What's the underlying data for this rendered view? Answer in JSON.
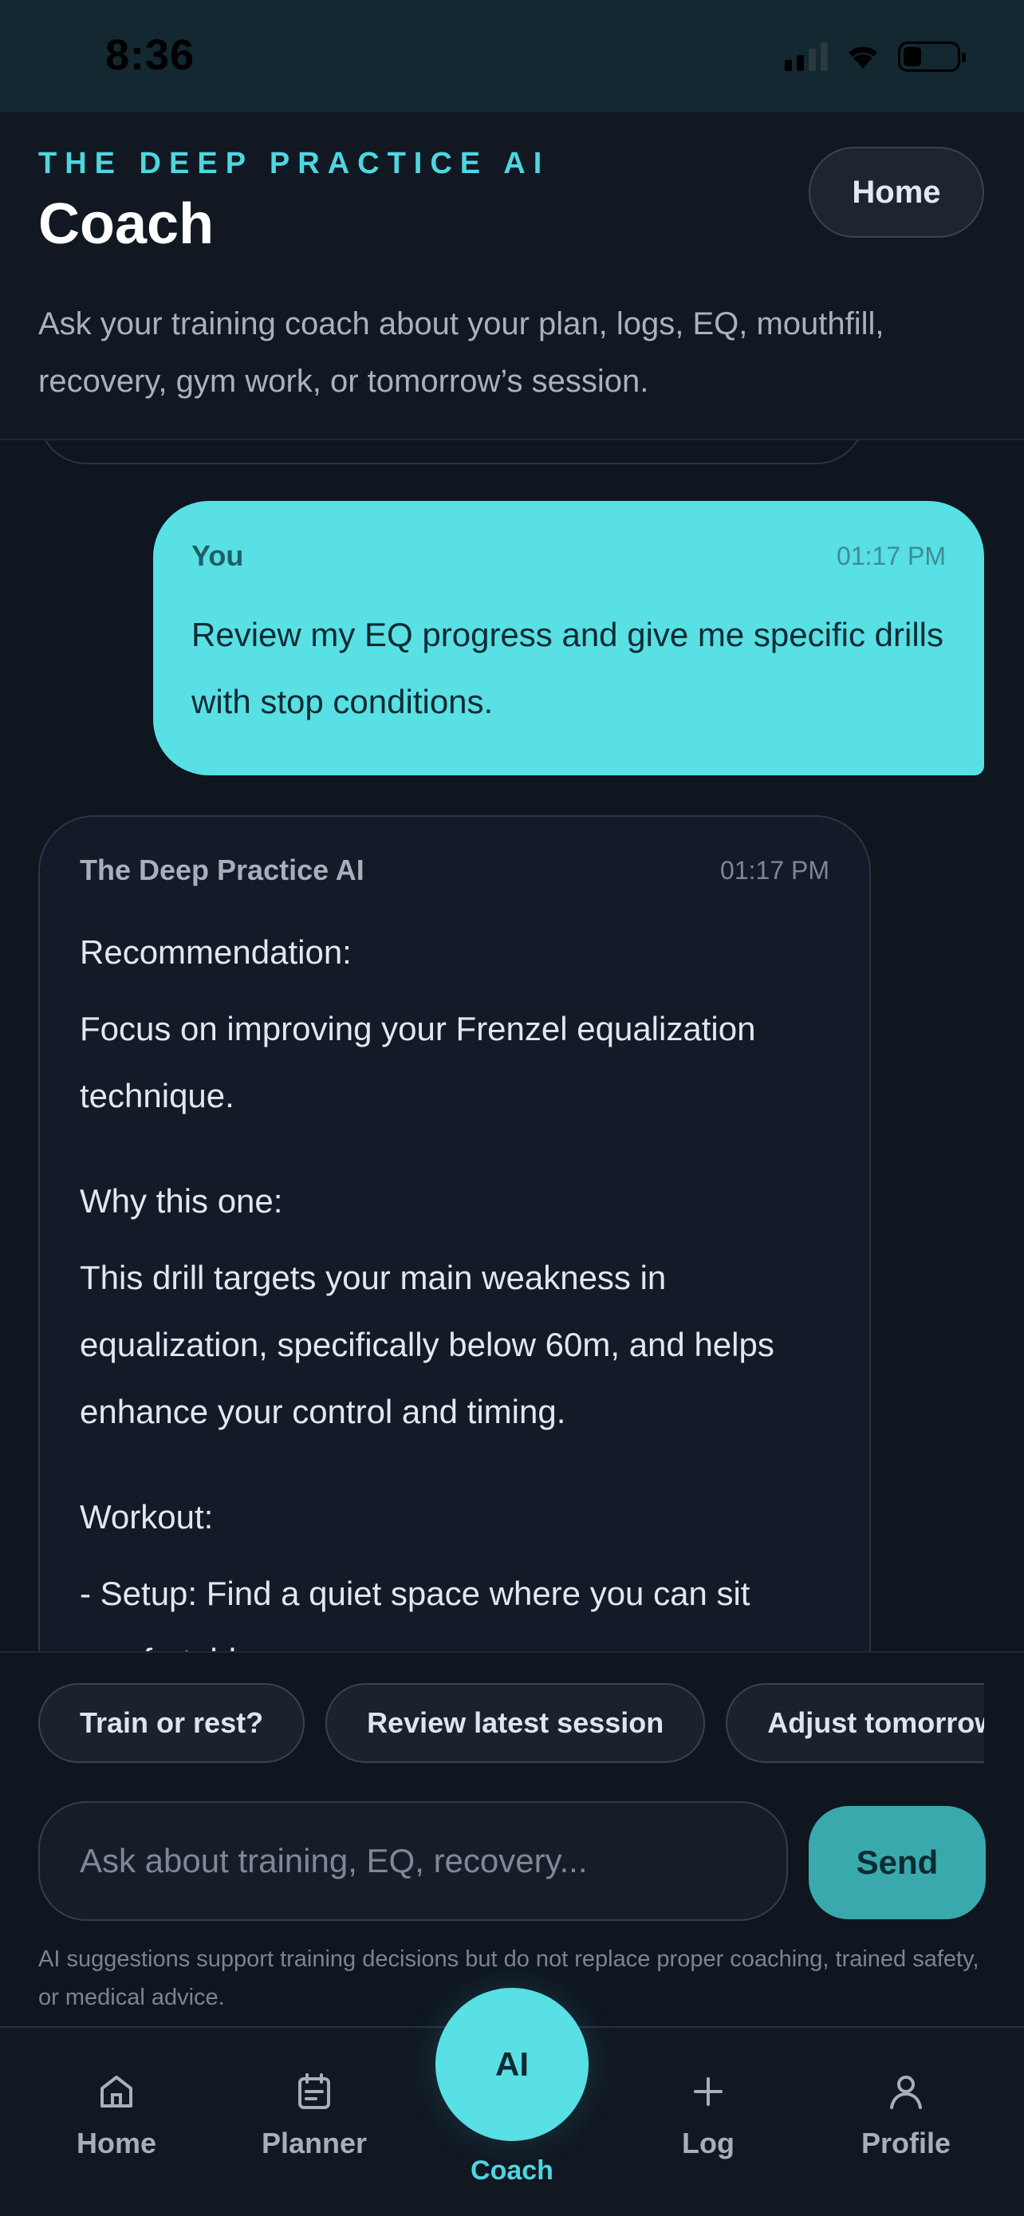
{
  "status_bar": {
    "time": "8:36"
  },
  "header": {
    "eyebrow": "THE DEEP PRACTICE AI",
    "title": "Coach",
    "home_button": "Home",
    "subtitle": "Ask your training coach about your plan, logs, EQ, mouthfill, recovery, gym work, or tomorrow’s session."
  },
  "messages": [
    {
      "sender": "You",
      "time": "01:17 PM",
      "text": "Review my EQ progress and give me specific drills with stop conditions."
    },
    {
      "sender": "The Deep Practice AI",
      "time": "01:17 PM",
      "paragraphs": [
        "Recommendation:",
        "Focus on improving your Frenzel equalization technique.",
        "Why this one:",
        "This drill targets your main weakness in equalization, specifically below 60m, and helps enhance your control and timing.",
        "Workout:",
        "- Setup: Find a quiet space where you can sit comfortably."
      ]
    }
  ],
  "quick_replies": [
    "Train or rest?",
    "Review latest session",
    "Adjust tomorrow"
  ],
  "composer": {
    "placeholder": "Ask about training, EQ, recovery...",
    "send_label": "Send",
    "disclaimer": "AI suggestions support training decisions but do not replace proper coaching, trained safety, or medical advice."
  },
  "bottom_nav": {
    "items": [
      {
        "label": "Home",
        "icon": "home-icon"
      },
      {
        "label": "Planner",
        "icon": "planner-icon"
      },
      {
        "label": "Coach",
        "icon": "ai-badge",
        "badge": "AI",
        "active": true
      },
      {
        "label": "Log",
        "icon": "plus-icon"
      },
      {
        "label": "Profile",
        "icon": "profile-icon"
      }
    ]
  },
  "colors": {
    "accent": "#58e0e4",
    "background": "#0f1620",
    "send_button": "#3aa9ad"
  }
}
